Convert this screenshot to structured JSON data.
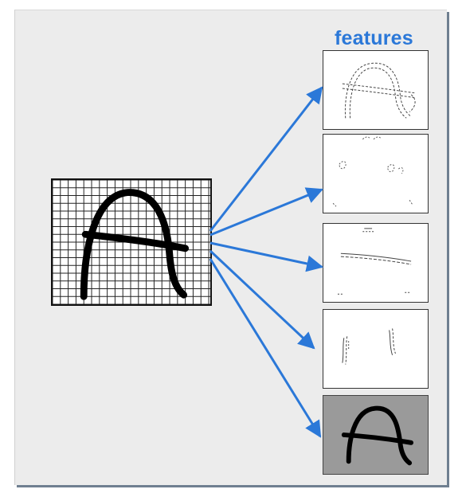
{
  "diagram": {
    "title": "features",
    "accent_color": "#2b78d8",
    "input": {
      "glyph": "letter-A"
    },
    "features": [
      {
        "name": "outline"
      },
      {
        "name": "corners"
      },
      {
        "name": "horizontal-bar"
      },
      {
        "name": "vertical-strokes"
      },
      {
        "name": "whole-letter"
      }
    ]
  }
}
